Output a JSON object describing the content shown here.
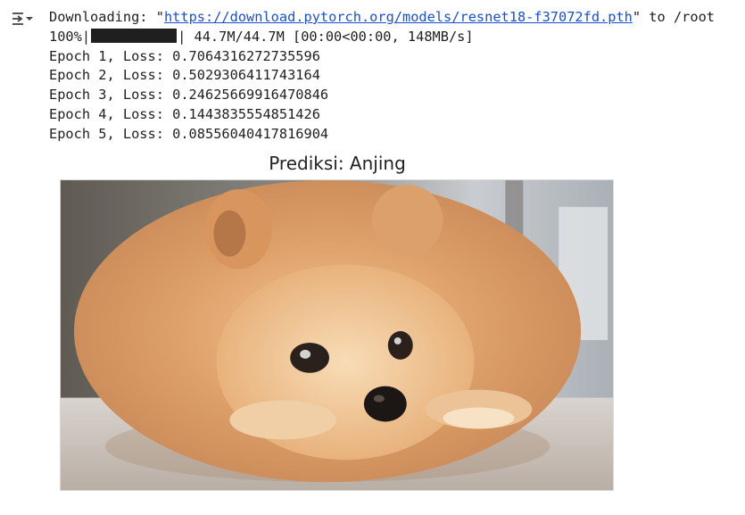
{
  "output": {
    "download_prefix": "Downloading: \"",
    "download_url": "https://download.pytorch.org/models/resnet18-f37072fd.pth",
    "download_suffix": "\" to /root",
    "progress_percent": "100%|",
    "progress_fraction": 1.0,
    "progress_stats": "| 44.7M/44.7M [00:00<00:00, 148MB/s]",
    "epochs": [
      "Epoch 1, Loss: 0.7064316272735596",
      "Epoch 2, Loss: 0.5029306411743164",
      "Epoch 3, Loss: 0.24625669916470846",
      "Epoch 4, Loss: 0.1443835554851426",
      "Epoch 5, Loss: 0.08556040417816904"
    ]
  },
  "figure": {
    "title": "Prediksi: Anjing",
    "image_subject": "pomeranian-dog-photo"
  },
  "icons": {
    "output_toggle": "collapse-output-icon"
  }
}
